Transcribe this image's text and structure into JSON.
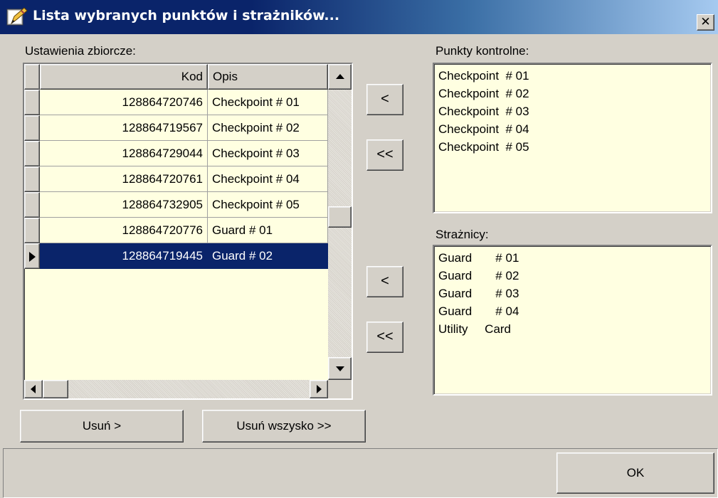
{
  "window": {
    "title": "Lista wybranych punktów i strażników...",
    "close_glyph": "✕"
  },
  "left_panel": {
    "label": "Ustawienia zbiorcze:",
    "columns": {
      "kod": "Kod",
      "opis": "Opis"
    },
    "rows": [
      {
        "kod": "128864720746",
        "opis": "Checkpoint  # 01"
      },
      {
        "kod": "128864719567",
        "opis": "Checkpoint  # 02"
      },
      {
        "kod": "128864729044",
        "opis": "Checkpoint  # 03"
      },
      {
        "kod": "128864720761",
        "opis": "Checkpoint  # 04"
      },
      {
        "kod": "128864732905",
        "opis": "Checkpoint  # 05"
      },
      {
        "kod": "128864720776",
        "opis": "Guard       # 01"
      },
      {
        "kod": "128864719445",
        "opis": "Guard       # 02"
      }
    ],
    "selected_row": 6,
    "remove_label": "Usuń >",
    "remove_all_label": "Usuń wszysko >>"
  },
  "move_buttons": {
    "single": "<",
    "all": "<<"
  },
  "checkpoints": {
    "label": "Punkty kontrolne:",
    "items": [
      "Checkpoint  # 01",
      "Checkpoint  # 02",
      "Checkpoint  # 03",
      "Checkpoint  # 04",
      "Checkpoint  # 05"
    ]
  },
  "guards": {
    "label": "Strażnicy:",
    "items": [
      "Guard       # 01",
      "Guard       # 02",
      "Guard       # 03",
      "Guard       # 04",
      "Utility     Card"
    ]
  },
  "footer": {
    "ok_label": "OK"
  },
  "colors": {
    "selection": "#0a246a",
    "list_background": "#ffffe1",
    "face": "#d4d0c8"
  },
  "icons": {
    "title": "pencil-app-icon",
    "close": "close-icon"
  }
}
